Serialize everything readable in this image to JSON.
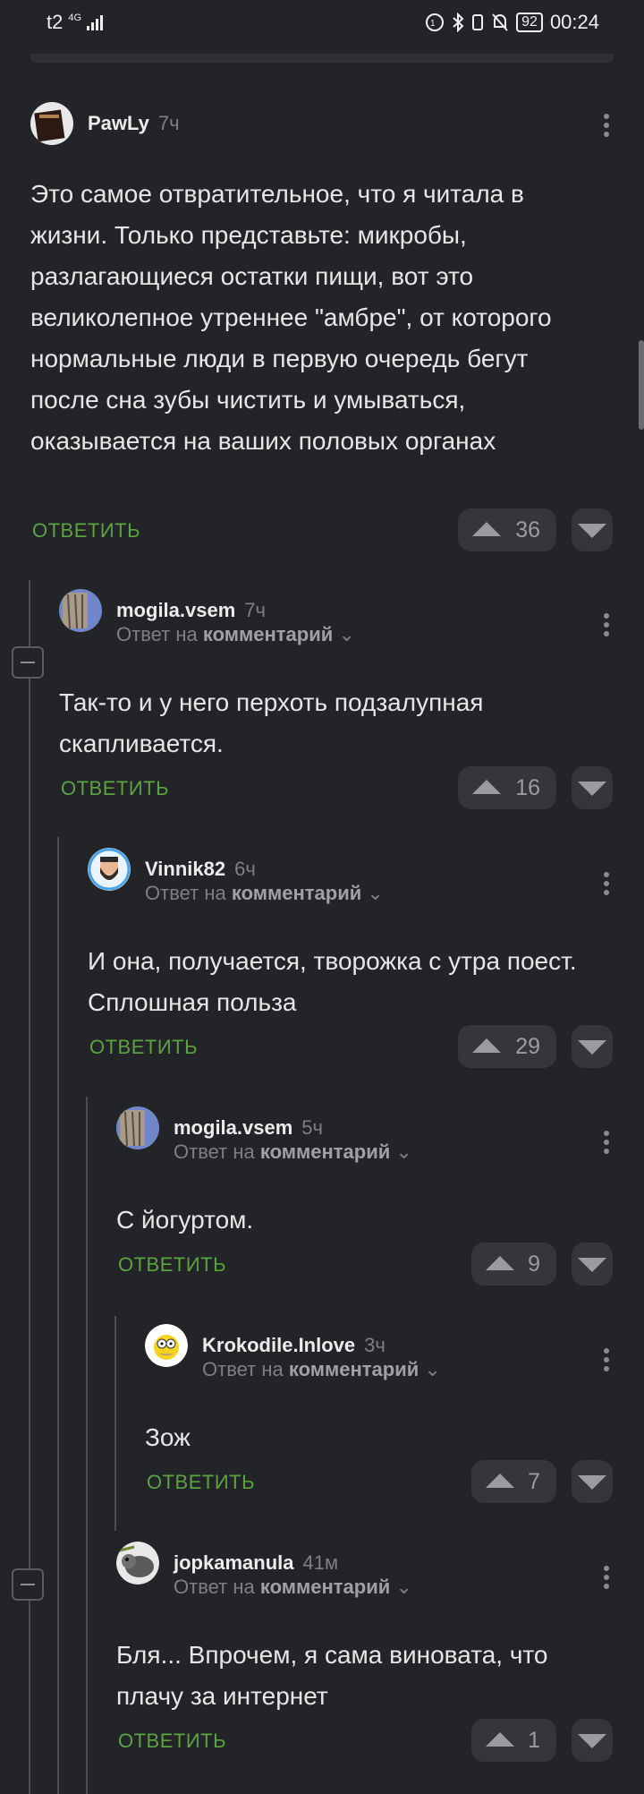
{
  "status": {
    "carrier": "t2",
    "network": "4G",
    "battery": "92",
    "time": "00:24"
  },
  "comments": [
    {
      "author": "PawLy",
      "time": "7ч",
      "reply_to_prefix": "",
      "reply_to_target": "",
      "text": "Это самое отвратительное, что я читала в жизни. Только представьте: микробы, разлагающиеся остатки пищи, вот это великолепное утреннее \"амбре\", от которого нормальные люди в первую очередь бегут после сна зубы чистить и умываться, оказывается на ваших половых органах",
      "reply_label": "ОТВЕТИТЬ",
      "rating": "36"
    },
    {
      "author": "mogila.vsem",
      "time": "7ч",
      "reply_to_prefix": "Ответ на",
      "reply_to_target": "комментарий",
      "text": "Так-то и у него перхоть подзалупная скапливается.",
      "reply_label": "ОТВЕТИТЬ",
      "rating": "16"
    },
    {
      "author": "Vinnik82",
      "time": "6ч",
      "reply_to_prefix": "Ответ на",
      "reply_to_target": "комментарий",
      "text": "И она, получается, творожка с утра поест. Сплошная польза",
      "reply_label": "ОТВЕТИТЬ",
      "rating": "29"
    },
    {
      "author": "mogila.vsem",
      "time": "5ч",
      "reply_to_prefix": "Ответ на",
      "reply_to_target": "комментарий",
      "text": "С йогуртом.",
      "reply_label": "ОТВЕТИТЬ",
      "rating": "9"
    },
    {
      "author": "Krokodile.Inlove",
      "time": "3ч",
      "reply_to_prefix": "Ответ на",
      "reply_to_target": "комментарий",
      "text": "Зож",
      "reply_label": "ОТВЕТИТЬ",
      "rating": "7"
    },
    {
      "author": "jopkamanula",
      "time": "41м",
      "reply_to_prefix": "Ответ на",
      "reply_to_target": "комментарий",
      "text": "Бля... Впрочем, я сама виновата, что плачу за интернет",
      "reply_label": "ОТВЕТИТЬ",
      "rating": "1"
    }
  ]
}
